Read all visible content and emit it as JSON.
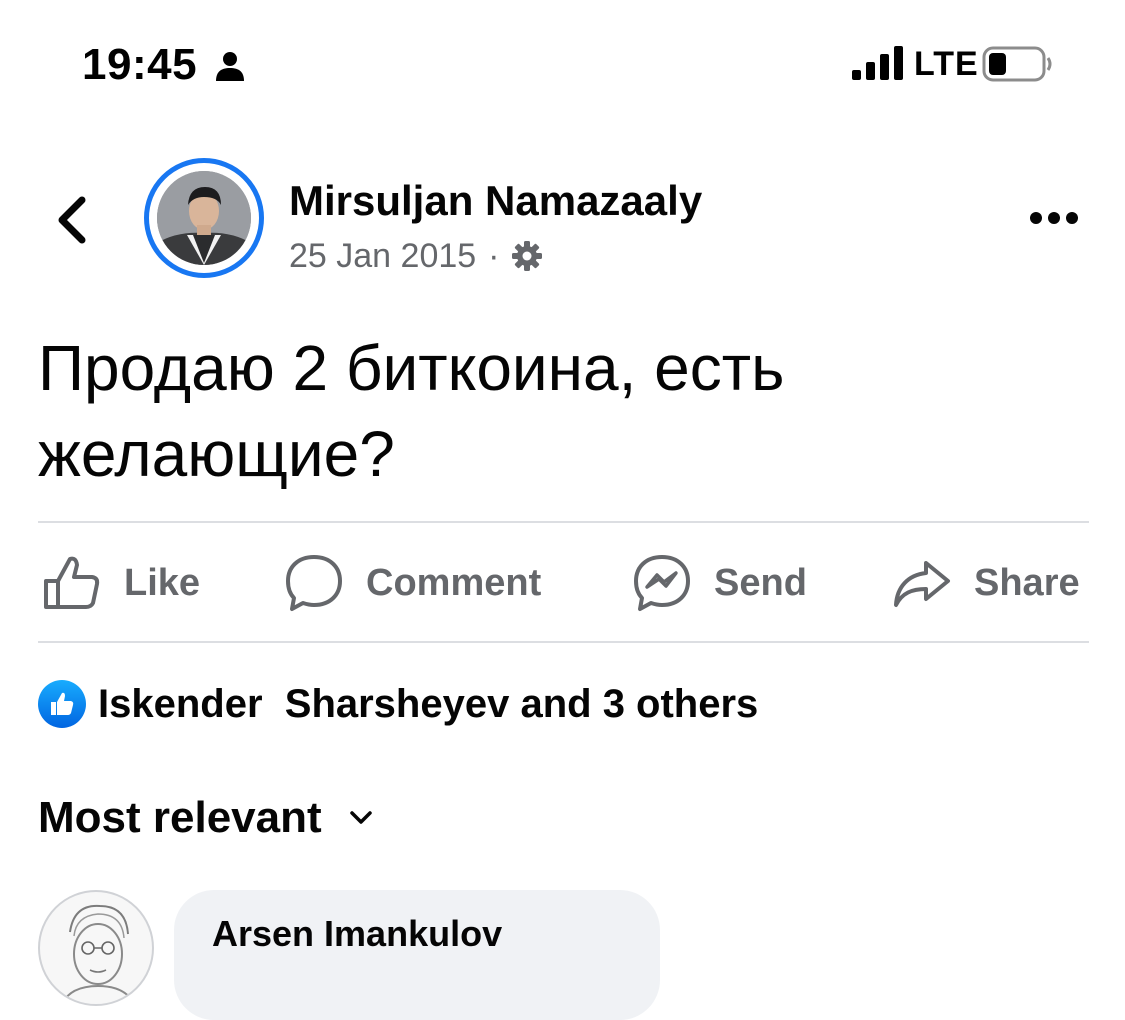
{
  "status_bar": {
    "time": "19:45",
    "network": "LTE"
  },
  "post": {
    "author": "Mirsuljan Namazaaly",
    "date": "25 Jan 2015",
    "separator": "·",
    "privacy_icon": "gear-icon",
    "text": "Продаю 2 биткоина, есть желающие?"
  },
  "actions": {
    "like": "Like",
    "comment": "Comment",
    "send": "Send",
    "share": "Share"
  },
  "reactions": {
    "summary": "Iskender  Sharsheyev and 3 others"
  },
  "comments": {
    "sort_label": "Most relevant",
    "items": [
      {
        "author": "Arsen Imankulov"
      }
    ]
  },
  "colors": {
    "accent": "#1877f2",
    "secondary_text": "#65676b",
    "divider": "#dcdee2",
    "bubble": "#f0f2f5"
  }
}
